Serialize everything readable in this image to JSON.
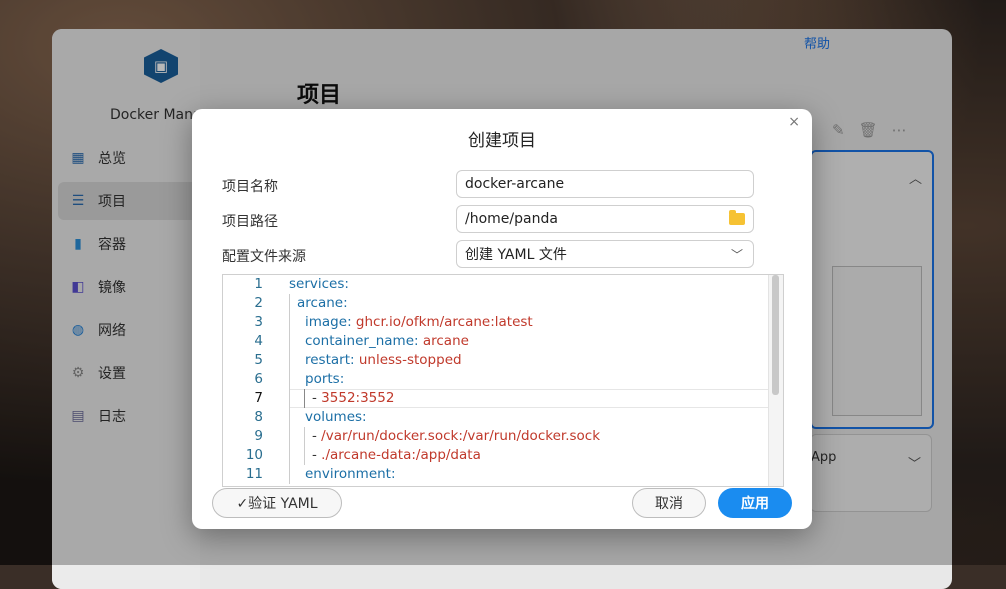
{
  "app": {
    "name": "Docker Mana",
    "page_title": "项目",
    "top_link": "帮助",
    "panel_text": "App",
    "nav": [
      {
        "label": "总览",
        "icon": "grid-icon",
        "color": "#2b6cb0"
      },
      {
        "label": "项目",
        "icon": "list-icon",
        "color": "#2b6cb0"
      },
      {
        "label": "容器",
        "icon": "container-icon",
        "color": "#2b8fd9"
      },
      {
        "label": "镜像",
        "icon": "image-icon",
        "color": "#5a4fcf"
      },
      {
        "label": "网络",
        "icon": "globe-icon",
        "color": "#1f7fd6"
      },
      {
        "label": "设置",
        "icon": "gear-icon",
        "color": "#8a8a8a"
      },
      {
        "label": "日志",
        "icon": "log-icon",
        "color": "#6a6a9a"
      }
    ]
  },
  "dialog": {
    "title": "创建项目",
    "close": "×",
    "project_name_label": "项目名称",
    "project_name_value": "docker-arcane",
    "project_path_label": "项目路径",
    "project_path_value": "/home/panda",
    "config_source_label": "配置文件来源",
    "config_source_value": "创建 YAML 文件",
    "buttons": {
      "validate": "✓验证 YAML",
      "cancel": "取消",
      "apply": "应用"
    }
  },
  "editor": {
    "lines": [
      {
        "n": "1",
        "key": "services",
        "sep": ":",
        "val": ""
      },
      {
        "n": "2",
        "key": "arcane",
        "sep": ":",
        "val": ""
      },
      {
        "n": "3",
        "key": "image",
        "sep": ": ",
        "val": "ghcr.io/ofkm/arcane:latest"
      },
      {
        "n": "4",
        "key": "container_name",
        "sep": ": ",
        "val": "arcane"
      },
      {
        "n": "5",
        "key": "restart",
        "sep": ": ",
        "val": "unless-stopped"
      },
      {
        "n": "6",
        "key": "ports",
        "sep": ":",
        "val": ""
      },
      {
        "n": "7",
        "key": "",
        "sep": "- ",
        "val": "3552:3552"
      },
      {
        "n": "8",
        "key": "volumes",
        "sep": ":",
        "val": ""
      },
      {
        "n": "9",
        "key": "",
        "sep": "- ",
        "val": "/var/run/docker.sock:/var/run/docker.sock"
      },
      {
        "n": "10",
        "key": "",
        "sep": "- ",
        "val": "./arcane-data:/app/data"
      },
      {
        "n": "11",
        "key": "environment",
        "sep": ":",
        "val": ""
      }
    ],
    "active_line": "7"
  },
  "colors": {
    "accent": "#1a8cf0",
    "yaml_key": "#1c6fa6",
    "yaml_value": "#c0392b"
  }
}
